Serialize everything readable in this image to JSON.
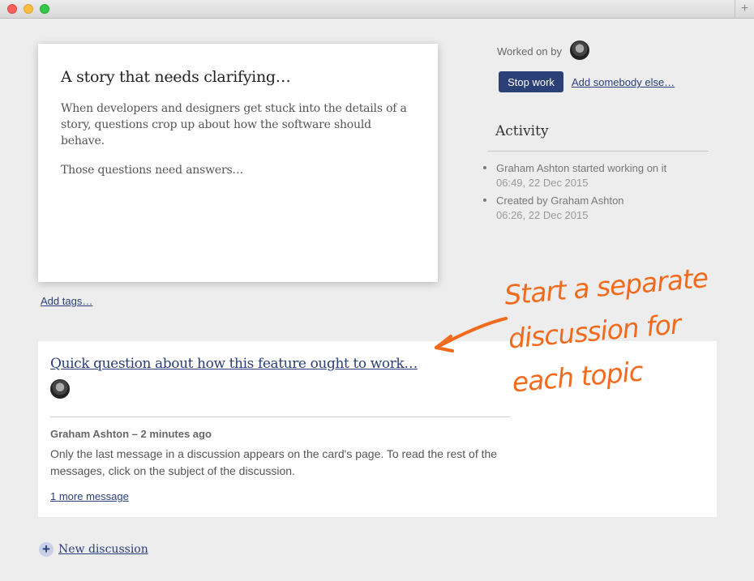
{
  "window": {
    "new_tab_glyph": "+"
  },
  "card": {
    "title": "A story that needs clarifying…",
    "paragraphs": [
      "When developers and designers get stuck into the details of a story, questions crop up about how the software should behave.",
      "Those questions need answers…"
    ],
    "add_tags_label": "Add tags…"
  },
  "sidebar": {
    "worked_on_label": "Worked on by",
    "stop_button_label": "Stop work",
    "add_somebody_label": "Add somebody else…",
    "activity_title": "Activity",
    "activity": [
      {
        "text": "Graham Ashton started working on it",
        "time": "06:49, 22 Dec 2015"
      },
      {
        "text": "Created by Graham Ashton",
        "time": "06:26, 22 Dec 2015"
      }
    ]
  },
  "discussion": {
    "subject": "Quick question about how this feature ought to work…",
    "author_line": "Graham Ashton – 2 minutes ago",
    "message": "Only the last message in a discussion appears on the card's page. To read the rest of the messages, click on the subject of the discussion.",
    "more_label": "1 more message"
  },
  "annotation": {
    "lines": [
      "Start a separate",
      "discussion for",
      "each topic"
    ],
    "color": "#f26b1d"
  },
  "new_discussion_label": "New discussion",
  "colors": {
    "accent": "#2b4076",
    "link": "#2a3f7a"
  }
}
